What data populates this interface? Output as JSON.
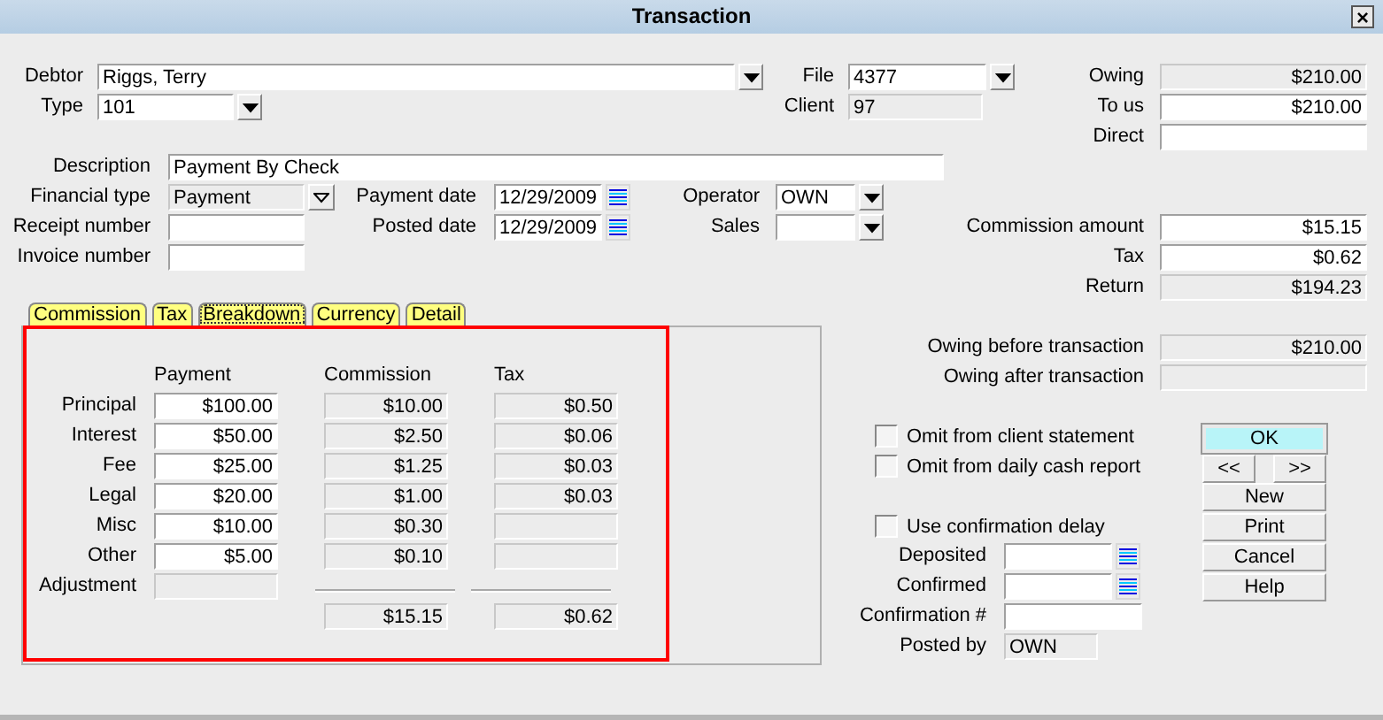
{
  "window": {
    "title": "Transaction",
    "close": "×"
  },
  "fields": [
    {
      "label": "Debtor",
      "value": "Riggs, Terry",
      "kind": "combo"
    },
    {
      "label": "File",
      "value": "4377",
      "kind": "combo"
    },
    {
      "label": "Owing",
      "value": "$210.00",
      "kind": "fixedamount"
    },
    {
      "label": "Type",
      "value": "101",
      "kind": "combo"
    },
    {
      "label": "Client",
      "value": "97",
      "kind": "readonly"
    },
    {
      "label": "To us",
      "value": "$210.00",
      "kind": "amount"
    },
    {
      "label": "Direct",
      "kind": "text"
    },
    {
      "label": "Description",
      "value": "Payment By Check",
      "kind": "text"
    },
    {
      "label": "Financial type",
      "value": "Payment",
      "kind": "select"
    },
    {
      "label": "Payment date",
      "value": "12/29/2009",
      "kind": "date"
    },
    {
      "label": "Operator",
      "value": "OWN",
      "kind": "combo"
    },
    {
      "label": "Receipt number",
      "kind": "text"
    },
    {
      "label": "Posted date",
      "value": "12/29/2009",
      "kind": "date"
    },
    {
      "label": "Sales",
      "kind": "combo"
    },
    {
      "label": "Commission amount",
      "value": "$15.15",
      "kind": "amount"
    },
    {
      "label": "Invoice number",
      "kind": "text"
    },
    {
      "label": "Tax",
      "value": "$0.62",
      "kind": "amount"
    },
    {
      "label": "Return",
      "value": "$194.23",
      "kind": "fixedamount"
    }
  ],
  "tabs": [
    {
      "label": "Commission",
      "selected": false
    },
    {
      "label": "Tax",
      "selected": false
    },
    {
      "label": "Breakdown",
      "selected": true
    },
    {
      "label": "Currency",
      "selected": false
    },
    {
      "label": "Detail",
      "selected": false
    }
  ],
  "breakdown": {
    "columns": [
      "Payment",
      "Commission",
      "Tax"
    ],
    "rows": [
      {
        "label": "Principal",
        "cells": [
          {
            "value": "$100.00",
            "editable": true
          },
          {
            "value": "$10.00",
            "editable": false
          },
          {
            "value": "$0.50",
            "editable": false
          }
        ]
      },
      {
        "label": "Interest",
        "cells": [
          {
            "value": "$50.00",
            "editable": true
          },
          {
            "value": "$2.50",
            "editable": false
          },
          {
            "value": "$0.06",
            "editable": false
          }
        ]
      },
      {
        "label": "Fee",
        "cells": [
          {
            "value": "$25.00",
            "editable": true
          },
          {
            "value": "$1.25",
            "editable": false
          },
          {
            "value": "$0.03",
            "editable": false
          }
        ]
      },
      {
        "label": "Legal",
        "cells": [
          {
            "value": "$20.00",
            "editable": true
          },
          {
            "value": "$1.00",
            "editable": false
          },
          {
            "value": "$0.03",
            "editable": false
          }
        ]
      },
      {
        "label": "Misc",
        "cells": [
          {
            "value": "$10.00",
            "editable": true
          },
          {
            "value": "$0.30",
            "editable": false
          },
          {
            "editable": false
          }
        ]
      },
      {
        "label": "Other",
        "cells": [
          {
            "value": "$5.00",
            "editable": true
          },
          {
            "value": "$0.10",
            "editable": false
          },
          {
            "editable": false
          }
        ]
      },
      {
        "label": "Adjustment",
        "cells": [
          {
            "editable": false
          }
        ]
      }
    ],
    "totals": [
      "$15.15",
      "$0.62"
    ]
  },
  "summary": [
    {
      "label": "Owing before transaction",
      "value": "$210.00",
      "kind": "fixedamount"
    },
    {
      "label": "Owing after transaction",
      "kind": "readonly"
    }
  ],
  "checkboxes": [
    {
      "label": "Omit from client statement",
      "checked": false
    },
    {
      "label": "Omit from daily cash report",
      "checked": false
    },
    {
      "label": "Use confirmation delay",
      "checked": false
    }
  ],
  "confirmation": [
    {
      "label": "Deposited",
      "kind": "date"
    },
    {
      "label": "Confirmed",
      "kind": "date"
    },
    {
      "label": "Confirmation #",
      "kind": "text"
    },
    {
      "label": "Posted by",
      "value": "OWN",
      "kind": "readonly"
    }
  ],
  "buttons": [
    {
      "label": "OK",
      "default": true
    },
    {
      "label": "<<",
      "default": false
    },
    {
      "label": ">>",
      "default": false
    },
    {
      "label": "New",
      "default": false
    },
    {
      "label": "Print",
      "default": false
    },
    {
      "label": "Cancel",
      "default": false
    },
    {
      "label": "Help",
      "default": false
    }
  ]
}
